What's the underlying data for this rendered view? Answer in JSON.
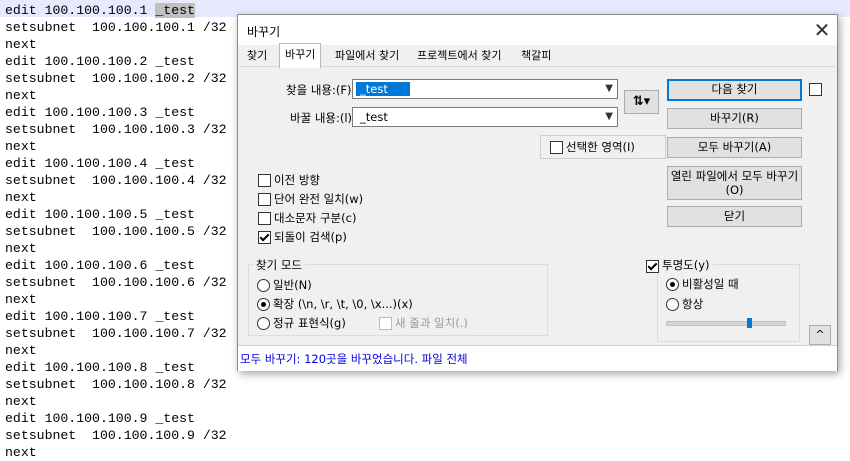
{
  "editor": {
    "lines": [
      "edit 100.100.100.1 _test",
      "setsubnet  100.100.100.1 /32",
      "next",
      "edit 100.100.100.2 _test",
      "setsubnet  100.100.100.2 /32",
      "next",
      "edit 100.100.100.3 _test",
      "setsubnet  100.100.100.3 /32",
      "next",
      "edit 100.100.100.4 _test",
      "setsubnet  100.100.100.4 /32",
      "next",
      "edit 100.100.100.5 _test",
      "setsubnet  100.100.100.5 /32",
      "next",
      "edit 100.100.100.6 _test",
      "setsubnet  100.100.100.6 /32",
      "next",
      "edit 100.100.100.7 _test",
      "setsubnet  100.100.100.7 /32",
      "next",
      "edit 100.100.100.8 _test",
      "setsubnet  100.100.100.8 /32",
      "next",
      "edit 100.100.100.9 _test",
      "setsubnet  100.100.100.9 /32",
      "next"
    ],
    "first_line_prefix": "edit 100.100.100.1 ",
    "first_line_selected": "_test"
  },
  "dialog": {
    "title": "바꾸기",
    "close_label": "✕",
    "tabs": [
      "찾기",
      "바꾸기",
      "파일에서 찾기",
      "프로젝트에서 찾기",
      "책갈피"
    ],
    "active_tab": "바꾸기",
    "find_label": "찾을 내용:(F)",
    "find_value": "_test",
    "replace_label": "바꿀 내용:(l)",
    "replace_value": "_test",
    "swap_icon": "swap-arrows-icon",
    "swap_glyph": "⇅▾",
    "in_selection_label": "선택한 영역(I)",
    "options": [
      {
        "label": "이전 방향",
        "checked": false
      },
      {
        "label": "단어 완전 일치(w)",
        "checked": false
      },
      {
        "label": "대소문자 구분(c)",
        "checked": false
      },
      {
        "label": "되돌이 검색(p)",
        "checked": true
      }
    ],
    "search_mode": {
      "title": "찾기 모드",
      "normal": "일반(N)",
      "extended": "확장 (\\n, \\r, \\t, \\0, \\x...)(x)",
      "regex": "정규 표현식(g)",
      "dot_newline": "새 줄과 일치(.)",
      "selected": "extended"
    },
    "buttons": {
      "find_next": "다음 찾기",
      "replace": "바꾸기(R)",
      "replace_all": "모두 바꾸기(A)",
      "replace_all_open_line1": "열린 파일에서 모두 바꾸기",
      "replace_all_open_line2": "(O)",
      "close": "닫기"
    },
    "transparency": {
      "title": "투명도(y)",
      "checked": true,
      "on_losing_focus": "비활성일 때",
      "always": "항상",
      "selected": "on_losing_focus",
      "level_fraction": 0.72
    },
    "collapse_glyph": "^",
    "status": "모두 바꾸기: 120곳을 바꾸었습니다. 파일 전체"
  }
}
